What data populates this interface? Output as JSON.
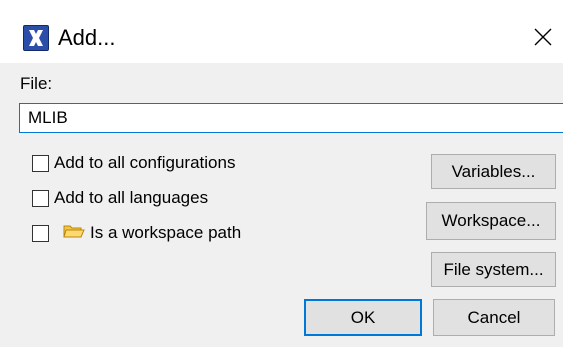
{
  "window": {
    "title": "Add...",
    "app_icon": "x-app-icon",
    "close_icon": "close-icon"
  },
  "file": {
    "label": "File:",
    "value": "MLIB"
  },
  "options": [
    {
      "label": "Add to all configurations",
      "checked": false
    },
    {
      "label": "Add to all languages",
      "checked": false
    },
    {
      "label": "Is a workspace path",
      "checked": false,
      "icon": "folder-icon"
    }
  ],
  "buttons": {
    "variables": "Variables...",
    "workspace": "Workspace...",
    "file_system": "File system...",
    "ok": "OK",
    "cancel": "Cancel"
  },
  "colors": {
    "accent": "#0078d7",
    "folder": "#f5c542"
  }
}
